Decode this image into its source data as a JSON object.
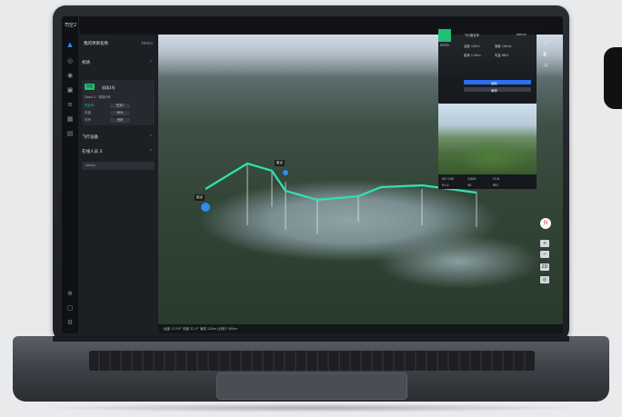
{
  "app": {
    "name": "司空2"
  },
  "side_panel": {
    "title": "我的项目名称",
    "user": "Admin",
    "section_devices": {
      "title": "机场"
    },
    "card": {
      "tag": "在线",
      "name": "机场1号",
      "subtitle": "Dock 2 · 机场1号",
      "rows": [
        {
          "label": "作业中",
          "value": "任务1"
        },
        {
          "label": "电量",
          "value": "88%"
        },
        {
          "label": "信号",
          "value": "良好"
        }
      ]
    },
    "section_devices2": {
      "title": "飞行设备"
    },
    "section_people": {
      "title": "在线人员 3"
    },
    "search_placeholder": "Admin"
  },
  "info_panel": {
    "header": "Admin",
    "tab_label": "M3TD",
    "rows": [
      "飞行器名称",
      "高度 120m",
      "速度 10m/s",
      "距离 1.2km",
      "电量 88%"
    ],
    "action_primary": "返航",
    "action_secondary": "悬停"
  },
  "video": {
    "stats": [
      "ISO 100",
      "1/500",
      "F2.8",
      "EV 0",
      "4K",
      "REC"
    ]
  },
  "map": {
    "waypoint_labels": [
      "起点",
      "航点"
    ],
    "compass": "N",
    "controls": [
      "+",
      "−",
      "2D",
      "◎"
    ],
    "status_text": "经度 113.9° 纬度 22.5°  海拔 120m  比例尺 500m"
  }
}
